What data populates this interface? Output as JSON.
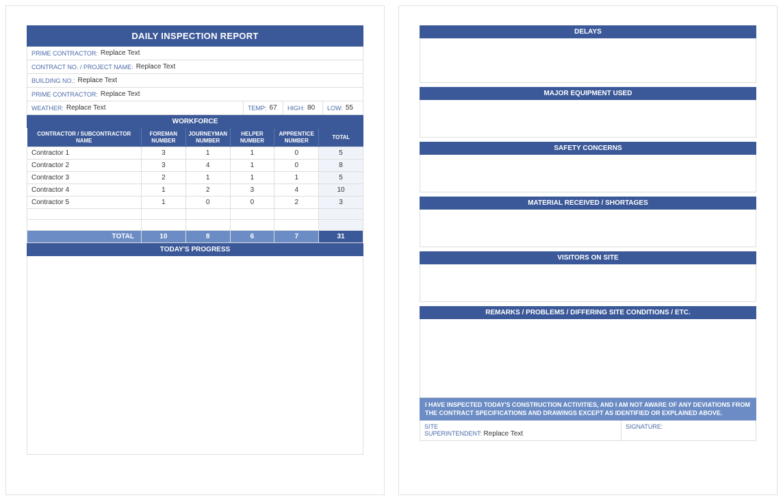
{
  "report": {
    "title": "DAILY INSPECTION REPORT",
    "fields": {
      "prime_contractor_label": "PRIME CONTRACTOR:",
      "prime_contractor_value": "Replace Text",
      "contract_no_label": "CONTRACT NO. / PROJECT NAME:",
      "contract_no_value": "Replace Text",
      "building_no_label": "BUILDING NO.:",
      "building_no_value": "Replace Text",
      "prime_contractor2_label": "PRIME CONTRACTOR:",
      "prime_contractor2_value": "Replace Text",
      "weather_label": "WEATHER:",
      "weather_value": "Replace Text",
      "temp_label": "TEMP:",
      "temp_value": "67",
      "high_label": "HIGH:",
      "high_value": "80",
      "low_label": "LOW:",
      "low_value": "55"
    },
    "workforce": {
      "header": "WORKFORCE",
      "columns": {
        "name": "CONTRACTOR / SUBCONTRACTOR NAME",
        "foreman": "FOREMAN NUMBER",
        "journeyman": "JOURNEYMAN NUMBER",
        "helper": "HELPER NUMBER",
        "apprentice": "APPRENTICE NUMBER",
        "total": "TOTAL"
      },
      "rows": [
        {
          "name": "Contractor 1",
          "foreman": "3",
          "journeyman": "1",
          "helper": "1",
          "apprentice": "0",
          "total": "5"
        },
        {
          "name": "Contractor 2",
          "foreman": "3",
          "journeyman": "4",
          "helper": "1",
          "apprentice": "0",
          "total": "8"
        },
        {
          "name": "Contractor 3",
          "foreman": "2",
          "journeyman": "1",
          "helper": "1",
          "apprentice": "1",
          "total": "5"
        },
        {
          "name": "Contractor 4",
          "foreman": "1",
          "journeyman": "2",
          "helper": "3",
          "apprentice": "4",
          "total": "10"
        },
        {
          "name": "Contractor 5",
          "foreman": "1",
          "journeyman": "0",
          "helper": "0",
          "apprentice": "2",
          "total": "3"
        }
      ],
      "total_label": "TOTAL",
      "totals": {
        "foreman": "10",
        "journeyman": "8",
        "helper": "6",
        "apprentice": "7",
        "total": "31"
      }
    },
    "progress_header": "TODAY'S PROGRESS"
  },
  "page2": {
    "sections": {
      "delays": "DELAYS",
      "equipment": "MAJOR EQUIPMENT USED",
      "safety": "SAFETY CONCERNS",
      "material": "MATERIAL RECEIVED / SHORTAGES",
      "visitors": "VISITORS ON SITE",
      "remarks": "REMARKS / PROBLEMS / DIFFERING SITE CONDITIONS / ETC."
    },
    "statement": "I HAVE INSPECTED TODAY'S CONSTRUCTION ACTIVITIES, AND I AM NOT AWARE OF ANY DEVIATIONS FROM THE CONTRACT SPECIFICATIONS AND DRAWINGS EXCEPT AS IDENTIFIED OR EXPLAINED ABOVE.",
    "signoff": {
      "super_label1": "SITE",
      "super_label2": "SUPERINTENDENT:",
      "super_value": "Replace Text",
      "signature_label": "SIGNATURE:"
    }
  }
}
